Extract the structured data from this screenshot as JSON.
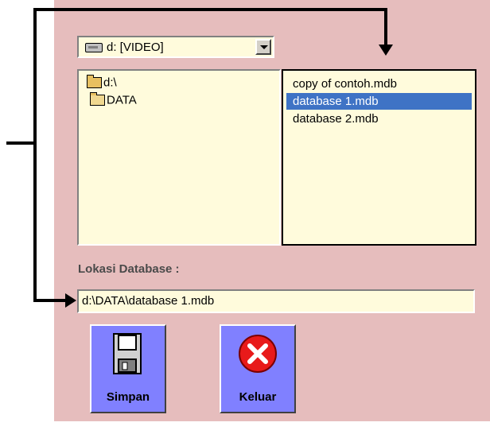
{
  "drive": {
    "label": "d: [VIDEO]",
    "icon": "drive-icon"
  },
  "directories": [
    {
      "label": "d:\\"
    },
    {
      "label": "DATA"
    }
  ],
  "files": [
    {
      "label": "copy of contoh.mdb"
    },
    {
      "label": "database 1.mdb"
    },
    {
      "label": "database 2.mdb"
    }
  ],
  "selected_file_index": 1,
  "location": {
    "label": "Lokasi Database :",
    "value": "d:\\DATA\\database 1.mdb"
  },
  "buttons": {
    "save": {
      "label": "Simpan",
      "icon": "floppy-disk-icon"
    },
    "exit": {
      "label": "Keluar",
      "icon": "close-icon"
    }
  },
  "colors": {
    "form_background": "#e6bdbd",
    "field_background": "#fffbdc",
    "selection": "#3f73c5",
    "button_face": "#8080ff"
  }
}
